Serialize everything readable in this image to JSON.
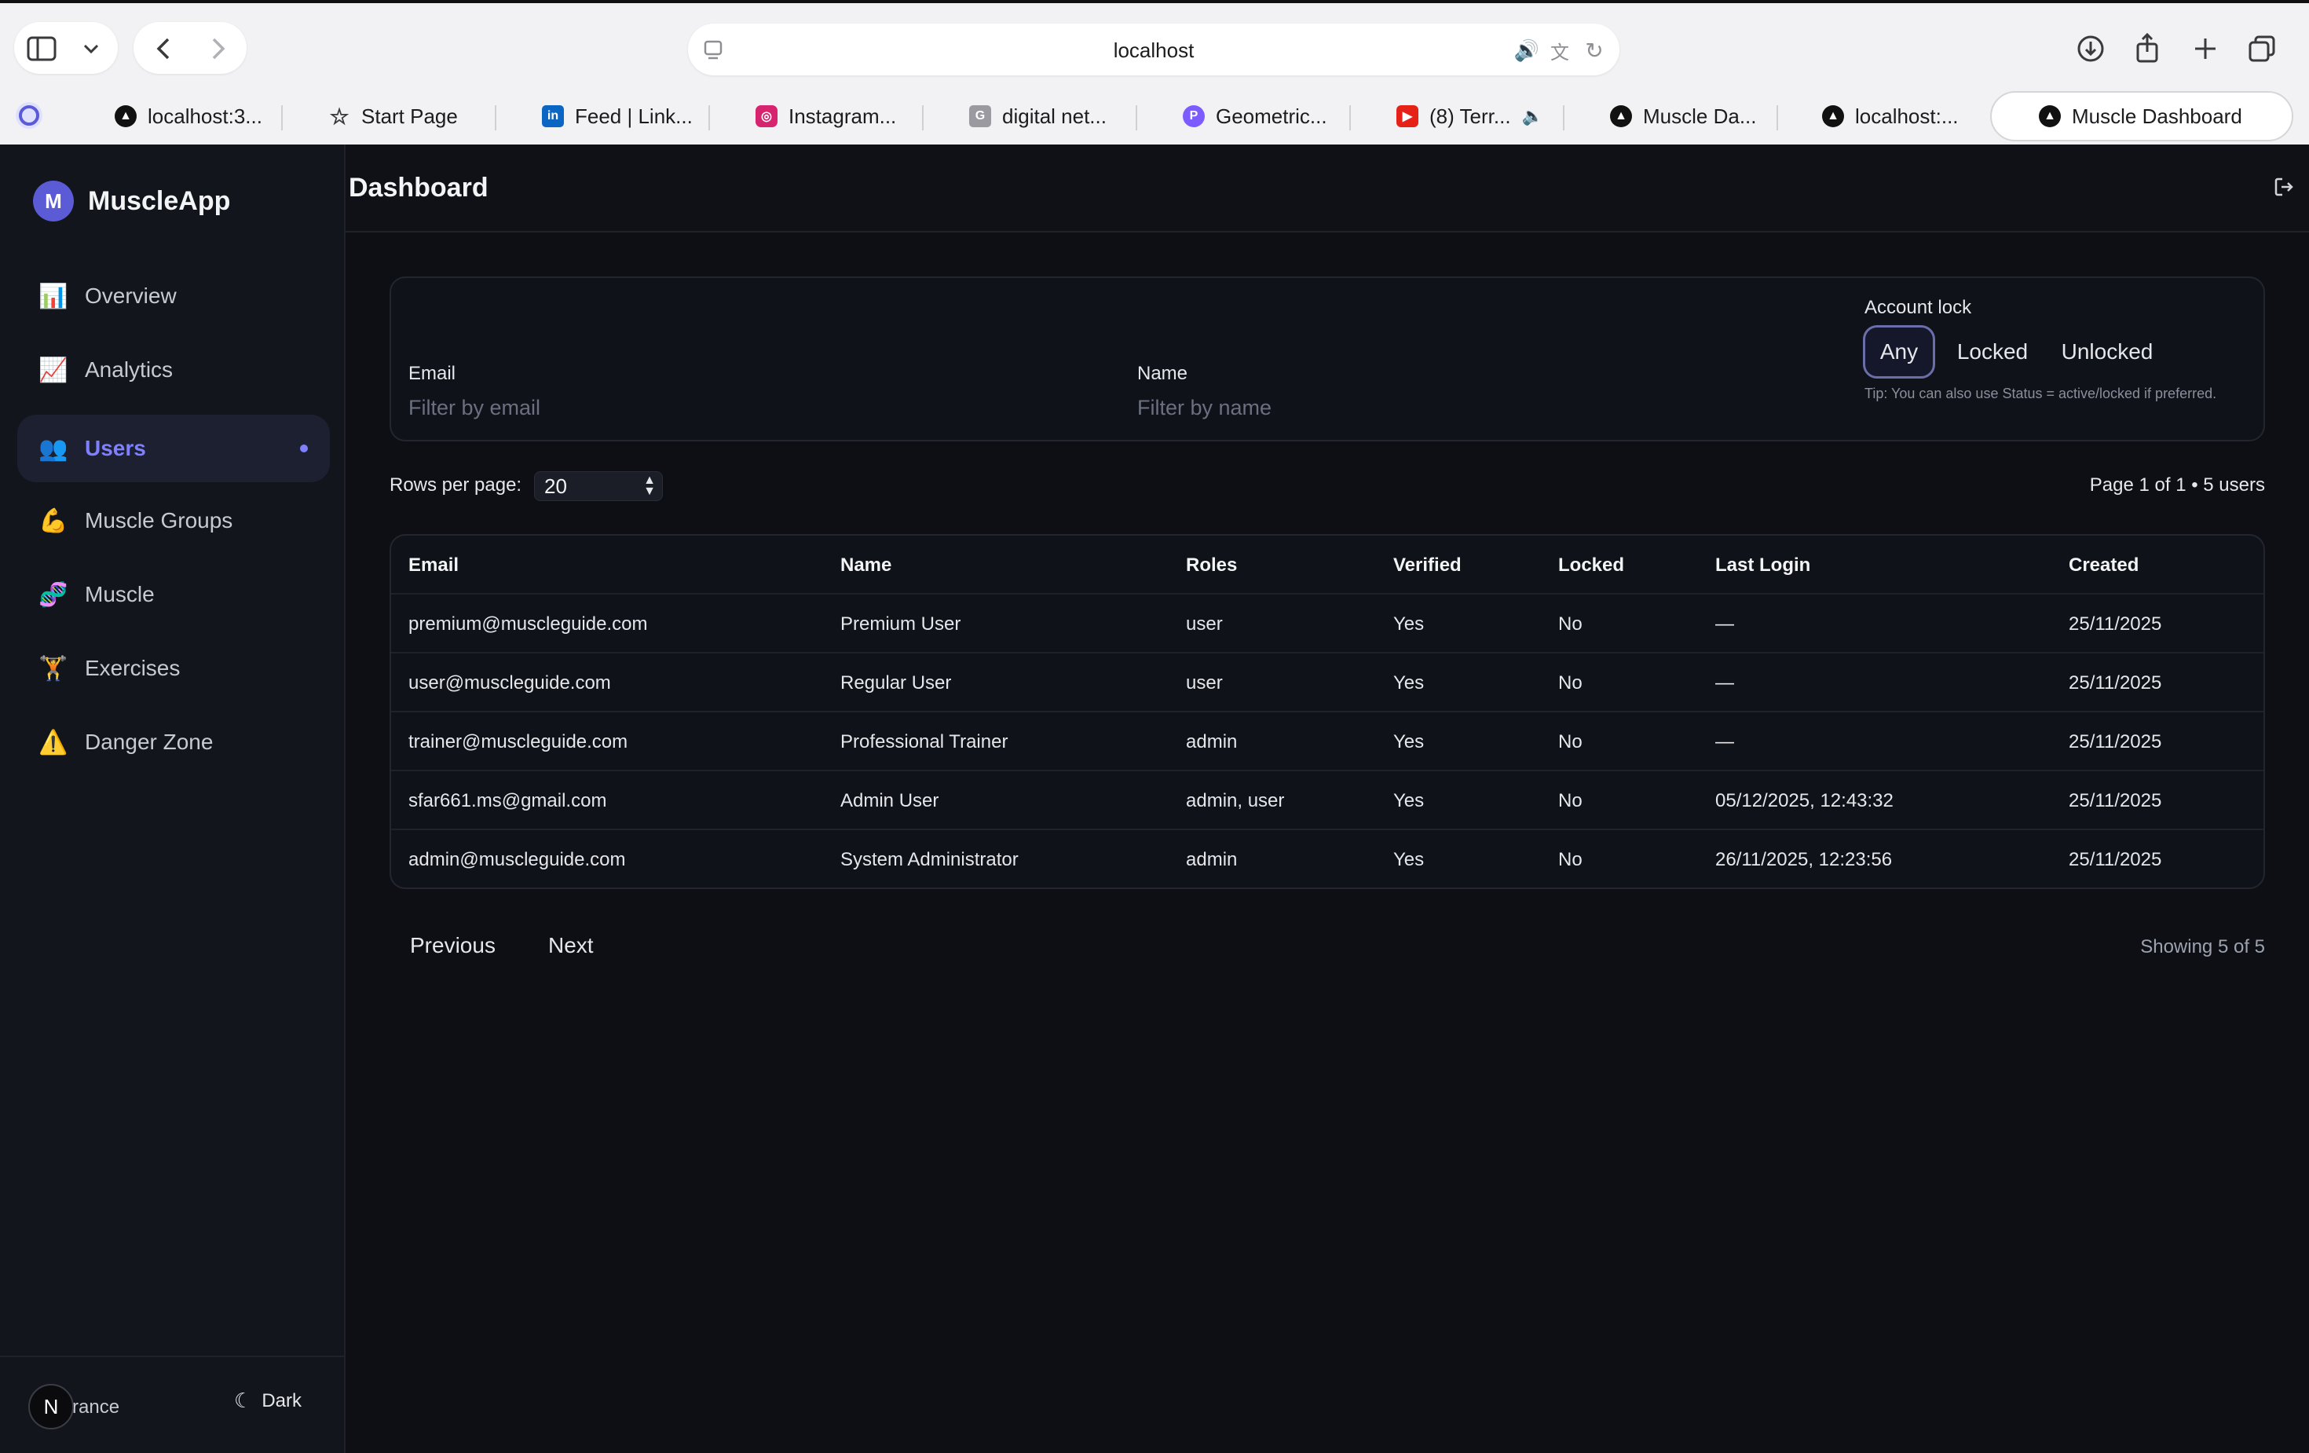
{
  "browser": {
    "address": "localhost",
    "tabs": [
      {
        "label": "localhost:3...",
        "icon": "nextjs-icon"
      },
      {
        "label": "Start Page",
        "icon": "star-icon"
      },
      {
        "label": "Feed | Link...",
        "icon": "linkedin-icon"
      },
      {
        "label": "Instagram...",
        "icon": "instagram-icon"
      },
      {
        "label": "digital net...",
        "icon": "g-icon"
      },
      {
        "label": "Geometric...",
        "icon": "pinterest-icon"
      },
      {
        "label": "(8) Terr...",
        "icon": "youtube-icon"
      },
      {
        "label": "Muscle Da...",
        "icon": "nextjs-icon"
      },
      {
        "label": "localhost:...",
        "icon": "nextjs-icon"
      },
      {
        "label": "Muscle Dashboard",
        "icon": "nextjs-icon"
      }
    ]
  },
  "sidebar": {
    "brand_initial": "M",
    "brand_name": "MuscleApp",
    "items": [
      {
        "label": "Overview",
        "icon": "bar-chart-icon"
      },
      {
        "label": "Analytics",
        "icon": "trend-chart-icon"
      },
      {
        "label": "Users",
        "icon": "users-icon"
      },
      {
        "label": "Muscle Groups",
        "icon": "flexed-biceps-icon"
      },
      {
        "label": "Muscle",
        "icon": "dna-icon"
      },
      {
        "label": "Exercises",
        "icon": "weightlifter-icon"
      },
      {
        "label": "Danger Zone",
        "icon": "warning-icon"
      }
    ],
    "footer": {
      "appearance_label": "rance",
      "avatar_letter": "N",
      "theme_label": "Dark"
    }
  },
  "header": {
    "title": "Dashboard"
  },
  "filters": {
    "email_label": "Email",
    "email_placeholder": "Filter by email",
    "name_label": "Name",
    "name_placeholder": "Filter by name",
    "lock_label": "Account lock",
    "lock_options": [
      "Any",
      "Locked",
      "Unlocked"
    ],
    "lock_selected": "Any",
    "tip": "Tip: You can also use Status = active/locked if preferred."
  },
  "pagination_top": {
    "rows_label": "Rows per page:",
    "rows_value": "20",
    "page_info": "Page 1 of 1 • 5 users"
  },
  "table": {
    "columns": [
      "Email",
      "Name",
      "Roles",
      "Verified",
      "Locked",
      "Last Login",
      "Created"
    ],
    "rows": [
      [
        "premium@muscleguide.com",
        "Premium User",
        "user",
        "Yes",
        "No",
        "—",
        "25/11/2025"
      ],
      [
        "user@muscleguide.com",
        "Regular User",
        "user",
        "Yes",
        "No",
        "—",
        "25/11/2025"
      ],
      [
        "trainer@muscleguide.com",
        "Professional Trainer",
        "admin",
        "Yes",
        "No",
        "—",
        "25/11/2025"
      ],
      [
        "sfar661.ms@gmail.com",
        "Admin User",
        "admin, user",
        "Yes",
        "No",
        "05/12/2025, 12:43:32",
        "25/11/2025"
      ],
      [
        "admin@muscleguide.com",
        "System Administrator",
        "admin",
        "Yes",
        "No",
        "26/11/2025, 12:23:56",
        "25/11/2025"
      ]
    ]
  },
  "pagination_bottom": {
    "previous": "Previous",
    "next": "Next",
    "showing": "Showing 5 of 5"
  }
}
